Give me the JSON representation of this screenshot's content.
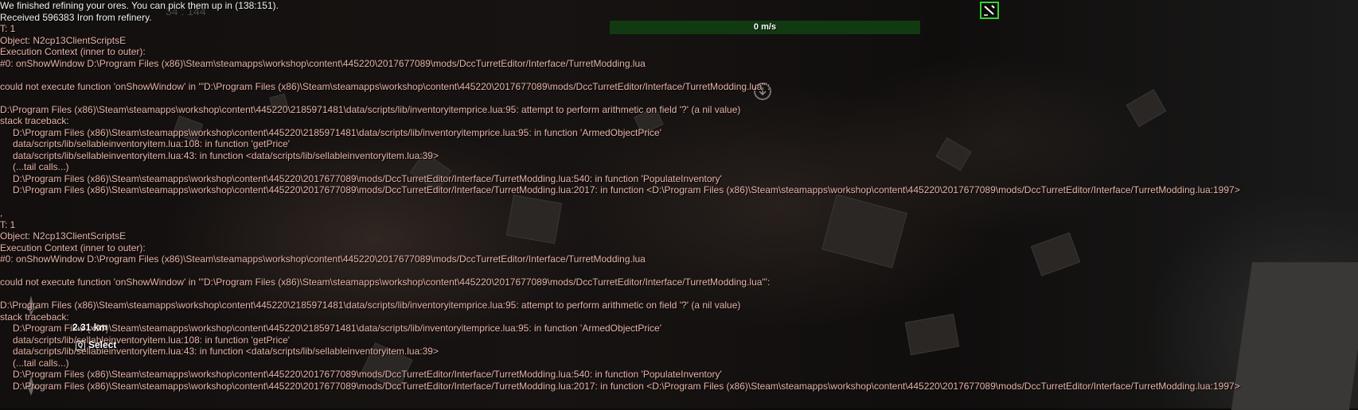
{
  "hud": {
    "speed_label": "0 m/s",
    "ghost_number": "34 : 144",
    "distance": "2.31 km",
    "select_key": "Q",
    "select_label": "Select"
  },
  "colors": {
    "accent": "#2fd62f",
    "log_text": "#e8b4a8",
    "info_text": "#f2f2f2"
  },
  "icons": {
    "target": "target-icon",
    "nav_marker": "nav-marker-icon",
    "ship": "ship-icon"
  },
  "console": {
    "lines": [
      {
        "text": "We finished refining your ores. You can pick them up in (138:151).",
        "style": "white",
        "indent": false
      },
      {
        "text": "Received 596383 Iron from refinery.",
        "style": "white",
        "indent": false
      },
      {
        "text": "T: 1",
        "style": "log",
        "indent": false
      },
      {
        "text": "Object: N2cp13ClientScriptsE",
        "style": "log",
        "indent": false
      },
      {
        "text": "Execution Context (inner to outer):",
        "style": "log",
        "indent": false
      },
      {
        "text": "#0: onShowWindow D:\\Program Files (x86)\\Steam\\steamapps\\workshop\\content\\445220\\2017677089\\mods/DccTurretEditor/Interface/TurretModding.lua",
        "style": "log",
        "indent": false
      },
      {
        "text": "",
        "style": "log",
        "indent": false
      },
      {
        "text": "could not execute function 'onShowWindow' in '\"D:\\Program Files (x86)\\Steam\\steamapps\\workshop\\content\\445220\\2017677089\\mods/DccTurretEditor/Interface/TurretModding.lua\"':",
        "style": "log",
        "indent": false
      },
      {
        "text": "",
        "style": "log",
        "indent": false
      },
      {
        "text": "D:\\Program Files (x86)\\Steam\\steamapps\\workshop\\content\\445220\\2185971481\\data/scripts/lib/inventoryitemprice.lua:95: attempt to perform arithmetic on field '?' (a nil value)",
        "style": "log",
        "indent": false
      },
      {
        "text": "stack traceback:",
        "style": "log",
        "indent": false
      },
      {
        "text": "D:\\Program Files (x86)\\Steam\\steamapps\\workshop\\content\\445220\\2185971481\\data/scripts/lib/inventoryitemprice.lua:95: in function 'ArmedObjectPrice'",
        "style": "log",
        "indent": true
      },
      {
        "text": "data/scripts/lib/sellableinventoryitem.lua:108: in function 'getPrice'",
        "style": "log",
        "indent": true
      },
      {
        "text": "data/scripts/lib/sellableinventoryitem.lua:43: in function <data/scripts/lib/sellableinventoryitem.lua:39>",
        "style": "log",
        "indent": true
      },
      {
        "text": "(...tail calls...)",
        "style": "log",
        "indent": true
      },
      {
        "text": "D:\\Program Files (x86)\\Steam\\steamapps\\workshop\\content\\445220\\2017677089\\mods/DccTurretEditor/Interface/TurretModding.lua:540: in function 'PopulateInventory'",
        "style": "log",
        "indent": true
      },
      {
        "text": "D:\\Program Files (x86)\\Steam\\steamapps\\workshop\\content\\445220\\2017677089\\mods/DccTurretEditor/Interface/TurretModding.lua:2017: in function <D:\\Program Files (x86)\\Steam\\steamapps\\workshop\\content\\445220\\2017677089\\mods/DccTurretEditor/Interface/TurretModding.lua:1997>",
        "style": "log",
        "indent": true
      },
      {
        "text": "",
        "style": "log",
        "indent": false
      },
      {
        "text": ",",
        "style": "log",
        "indent": false
      },
      {
        "text": "T: 1",
        "style": "log",
        "indent": false
      },
      {
        "text": "Object: N2cp13ClientScriptsE",
        "style": "log",
        "indent": false
      },
      {
        "text": "Execution Context (inner to outer):",
        "style": "log",
        "indent": false
      },
      {
        "text": "#0: onShowWindow D:\\Program Files (x86)\\Steam\\steamapps\\workshop\\content\\445220\\2017677089\\mods/DccTurretEditor/Interface/TurretModding.lua",
        "style": "log",
        "indent": false
      },
      {
        "text": "",
        "style": "log",
        "indent": false
      },
      {
        "text": "could not execute function 'onShowWindow' in '\"D:\\Program Files (x86)\\Steam\\steamapps\\workshop\\content\\445220\\2017677089\\mods/DccTurretEditor/Interface/TurretModding.lua\"':",
        "style": "log",
        "indent": false
      },
      {
        "text": "",
        "style": "log",
        "indent": false
      },
      {
        "text": "D:\\Program Files (x86)\\Steam\\steamapps\\workshop\\content\\445220\\2185971481\\data/scripts/lib/inventoryitemprice.lua:95: attempt to perform arithmetic on field '?' (a nil value)",
        "style": "log",
        "indent": false
      },
      {
        "text": "stack traceback:",
        "style": "log",
        "indent": false
      },
      {
        "text": "D:\\Program Files (x86)\\Steam\\steamapps\\workshop\\content\\445220\\2185971481\\data/scripts/lib/inventoryitemprice.lua:95: in function 'ArmedObjectPrice'",
        "style": "log",
        "indent": true
      },
      {
        "text": "data/scripts/lib/sellableinventoryitem.lua:108: in function 'getPrice'",
        "style": "log",
        "indent": true
      },
      {
        "text": "data/scripts/lib/sellableinventoryitem.lua:43: in function <data/scripts/lib/sellableinventoryitem.lua:39>",
        "style": "log",
        "indent": true
      },
      {
        "text": "(...tail calls...)",
        "style": "log",
        "indent": true
      },
      {
        "text": "D:\\Program Files (x86)\\Steam\\steamapps\\workshop\\content\\445220\\2017677089\\mods/DccTurretEditor/Interface/TurretModding.lua:540: in function 'PopulateInventory'",
        "style": "log",
        "indent": true
      },
      {
        "text": "D:\\Program Files (x86)\\Steam\\steamapps\\workshop\\content\\445220\\2017677089\\mods/DccTurretEditor/Interface/TurretModding.lua:2017: in function <D:\\Program Files (x86)\\Steam\\steamapps\\workshop\\content\\445220\\2017677089\\mods/DccTurretEditor/Interface/TurretModding.lua:1997>",
        "style": "log",
        "indent": true
      }
    ]
  }
}
